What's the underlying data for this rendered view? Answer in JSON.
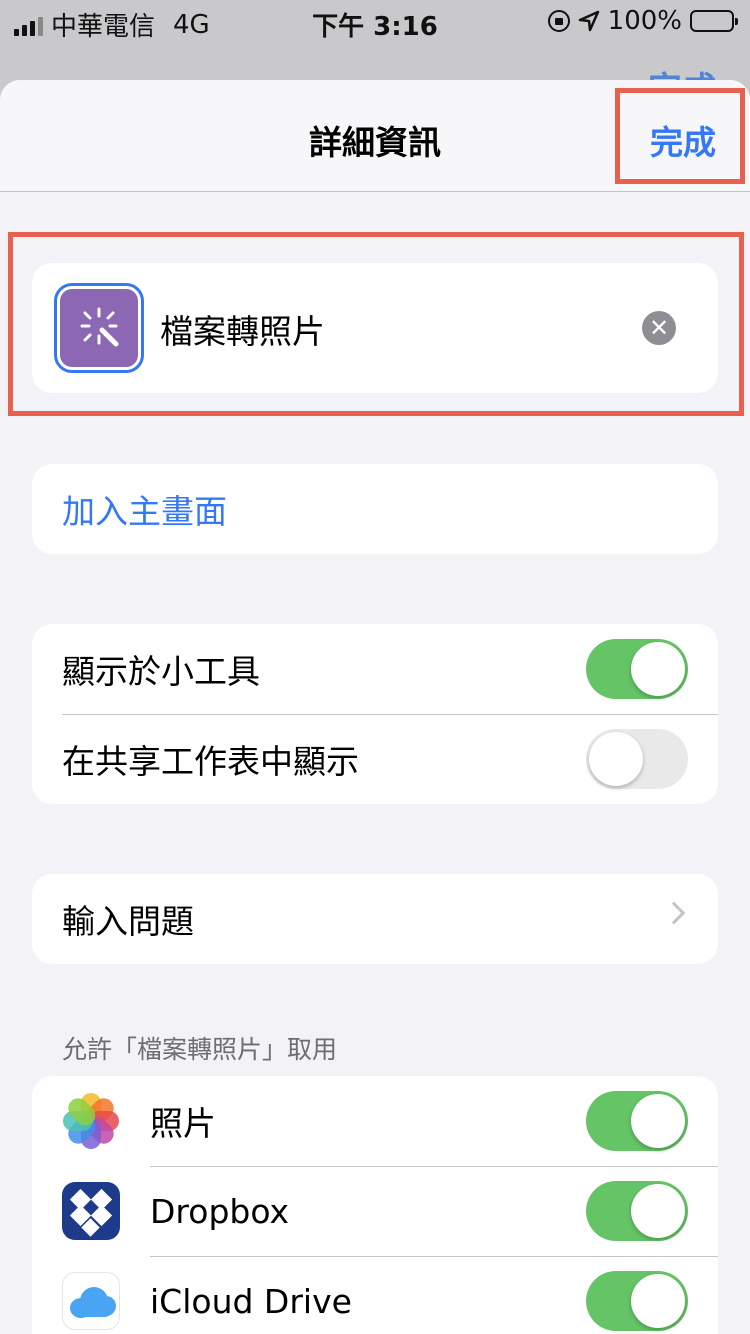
{
  "status_bar": {
    "carrier": "中華電信",
    "network": "4G",
    "time": "下午 3:16",
    "battery": "100%"
  },
  "background_done": "完成",
  "nav": {
    "title": "詳細資訊",
    "done_label": "完成"
  },
  "shortcut": {
    "name": "檔案轉照片",
    "icon": "magic-wand-icon",
    "icon_color": "#8c67b4"
  },
  "add_to_home": "加入主畫面",
  "toggles": [
    {
      "label": "顯示於小工具",
      "on": true
    },
    {
      "label": "在共享工作表中顯示",
      "on": false
    }
  ],
  "input_row": {
    "label": "輸入問題"
  },
  "apps_section": {
    "header": "允許「檔案轉照片」取用",
    "apps": [
      {
        "name": "照片",
        "icon": "photos-icon",
        "on": true
      },
      {
        "name": "Dropbox",
        "icon": "dropbox-icon",
        "on": true
      },
      {
        "name": "iCloud Drive",
        "icon": "icloud-icon",
        "on": true
      }
    ]
  },
  "colors": {
    "accent": "#3478f6",
    "switch_on": "#65c466",
    "highlight": "#e8604f"
  }
}
